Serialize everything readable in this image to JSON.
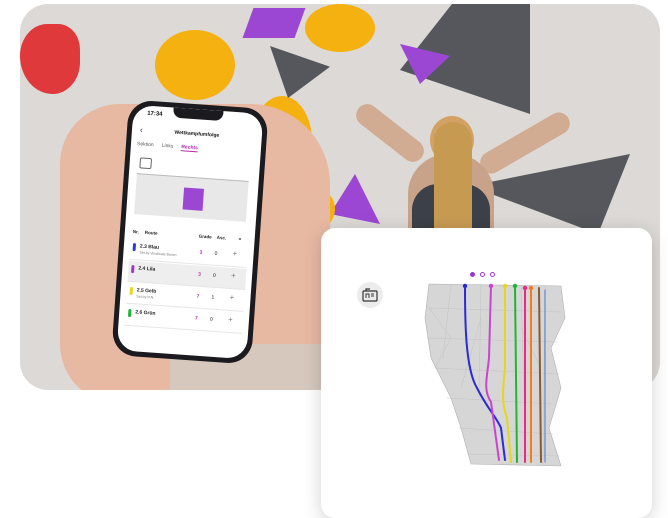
{
  "phone": {
    "status_time": "17:34",
    "title": "Wettkampfumfolge",
    "tabs": [
      {
        "label": "Sektion",
        "active": false
      },
      {
        "label": "Links",
        "active": false
      },
      {
        "label": "Rechts",
        "active": true
      }
    ],
    "table": {
      "col_no": "Nr.",
      "col_route": "Route",
      "col_grade": "Grade",
      "col_asc": "Asc."
    },
    "routes": [
      {
        "name": "2.3 Blau",
        "setter": "Set by Vendicate Brown",
        "grade": "3",
        "asc": "0",
        "color": "#2b3bd6",
        "selected": false
      },
      {
        "name": "2.4 Lila",
        "setter": "",
        "grade": "3",
        "asc": "0",
        "color": "#a036d4",
        "selected": true
      },
      {
        "name": "2.5 Gelb",
        "setter": "Set by N.N.",
        "grade": "7",
        "asc": "1",
        "color": "#e8d81a",
        "selected": false
      },
      {
        "name": "2.6 Grün",
        "setter": "",
        "grade": "7",
        "asc": "0",
        "color": "#1fb535",
        "selected": false
      }
    ],
    "add_symbol": "+"
  },
  "detail": {
    "pager_pages": 3,
    "pager_active": 0,
    "icon": "wall-plan-icon"
  },
  "colors": {
    "accent": "#b12cb0",
    "route_lines": [
      "#2b2bd6",
      "#cc44cc",
      "#e6d61c",
      "#1fb535",
      "#ea2a8a",
      "#f07d1e",
      "#8a5a2a",
      "#5a8ad6"
    ]
  }
}
